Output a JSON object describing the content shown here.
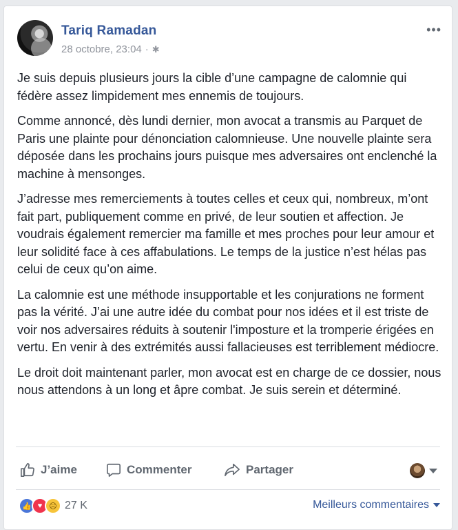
{
  "post": {
    "author": "Tariq Ramadan",
    "date": "28 octobre, 23:04",
    "separator": "·",
    "privacy_icon": "gear-icon",
    "more_icon": "more-icon",
    "more_label": "•••",
    "paragraphs": [
      "Je suis depuis plusieurs jours la cible d’une campagne de calomnie qui fédère assez limpidement mes ennemis de toujours.",
      "Comme annoncé, dès lundi dernier, mon avocat a transmis au Parquet de Paris une plainte pour dénonciation calomnieuse. Une nouvelle plainte sera déposée dans les prochains jours puisque mes adversaires ont enclenché la machine à mensonges.",
      "J’adresse mes remerciements à toutes celles et ceux qui, nombreux, m’ont fait part, publiquement comme en privé, de leur soutien et affection. Je voudrais également remercier ma famille et mes proches pour leur amour et leur solidité face à ces affabulations. Le temps de la justice n’est hélas pas celui de ceux qu’on aime.",
      "La calomnie est une méthode insupportable et les conjurations ne forment pas la vérité. J’ai une autre idée du combat pour nos idées et il est triste de voir nos adversaires réduits à soutenir l'imposture et la tromperie érigées en vertu. En venir à des extrémités aussi fallacieuses est terriblement médiocre.",
      "Le droit doit maintenant parler, mon avocat est en charge de ce dossier, nous nous attendons à un long et âpre combat. Je suis serein et déterminé."
    ]
  },
  "actions": {
    "like": "J’aime",
    "comment": "Commenter",
    "share": "Partager"
  },
  "footer": {
    "reaction_count": "27 K",
    "sort_label": "Meilleurs commentaires"
  },
  "colors": {
    "link_blue": "#365899",
    "meta_gray": "#90949c",
    "action_gray": "#606770"
  }
}
